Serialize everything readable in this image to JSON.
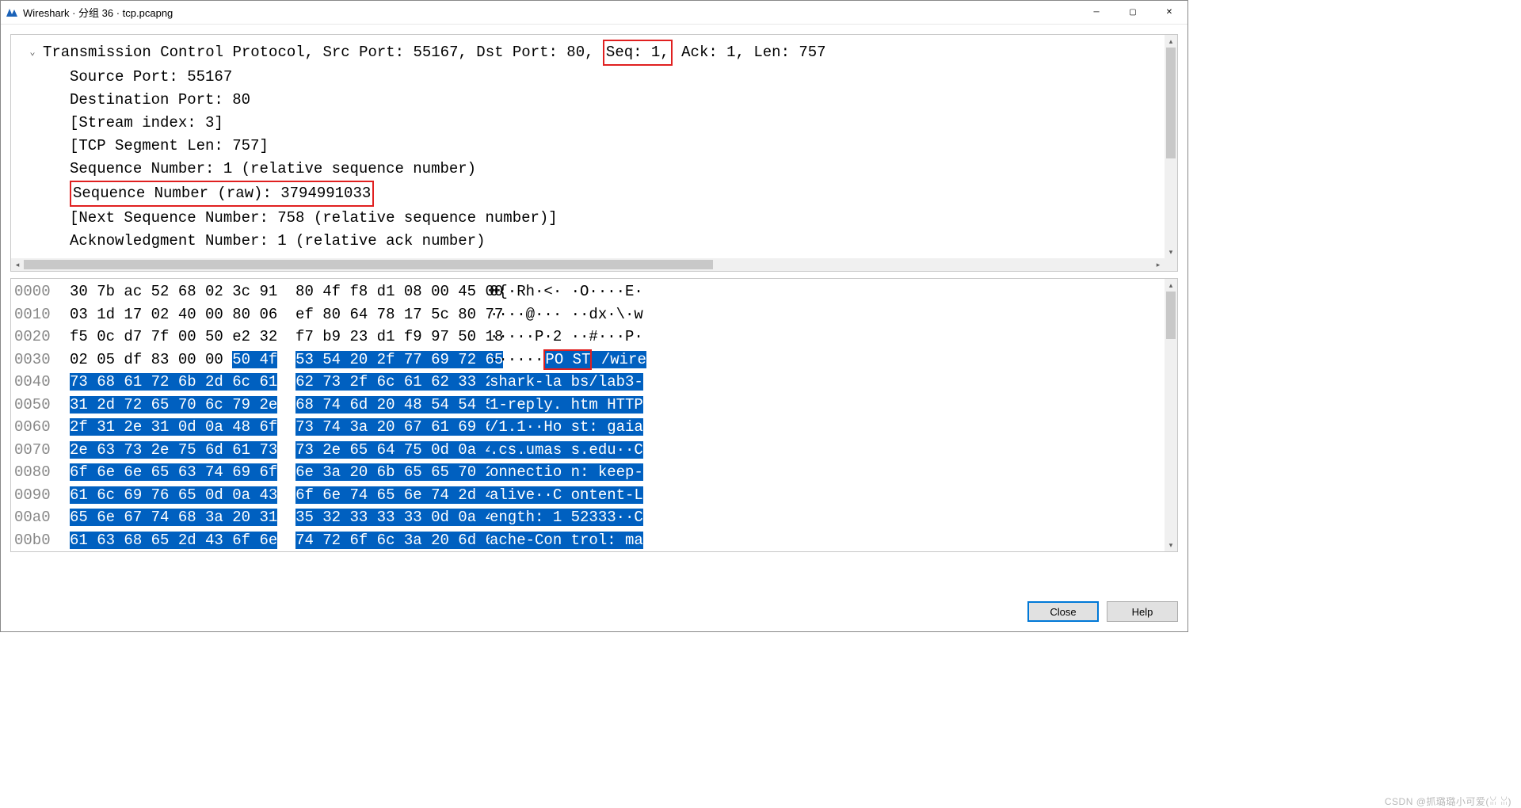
{
  "title": "Wireshark · 分组 36 · tcp.pcapng",
  "detail": {
    "header_line_pre": "Transmission Control Protocol, Src Port: 55167, Dst Port: 80, ",
    "header_line_seq": "Seq: 1,",
    "header_line_post": " Ack: 1, Len: 757",
    "lines": [
      "Source Port: 55167",
      "Destination Port: 80",
      "[Stream index: 3]",
      "[TCP Segment Len: 757]",
      "Sequence Number: 1    (relative sequence number)"
    ],
    "seq_raw_line": "Sequence Number (raw): 3794991033",
    "lines2": [
      "[Next Sequence Number: 758    (relative sequence number)]",
      "Acknowledgment Number: 1    (relative ack number)"
    ]
  },
  "hex": {
    "rows": [
      {
        "off": "0000",
        "b1": "30 7b ac 52 68 02 3c 91",
        "b2": "80 4f f8 d1 08 00 45 00",
        "a1": "0{·Rh·<·",
        "a2": " ·O····E·",
        "sel": 0
      },
      {
        "off": "0010",
        "b1": "03 1d 17 02 40 00 80 06",
        "b2": "ef 80 64 78 17 5c 80 77",
        "a1": "····@···",
        "a2": " ··dx·\\·w",
        "sel": 0
      },
      {
        "off": "0020",
        "b1": "f5 0c d7 7f 00 50 e2 32",
        "b2": "f7 b9 23 d1 f9 97 50 18",
        "a1": "·····P·2",
        "a2": " ··#···P·",
        "sel": 0
      },
      {
        "off": "0030",
        "b1p": "02 05 df 83 00 00 ",
        "b1s": "50 4f",
        "b2": "53 54 20 2f 77 69 72 65",
        "a1p": "······",
        "a1s1": "PO",
        "a1s2": " ST",
        "a2": " /wire",
        "sel": 1
      },
      {
        "off": "0040",
        "b1": "73 68 61 72 6b 2d 6c 61",
        "b2": "62 73 2f 6c 61 62 33 2d",
        "a1": "shark-la",
        "a2": " bs/lab3-",
        "sel": 2
      },
      {
        "off": "0050",
        "b1": "31 2d 72 65 70 6c 79 2e",
        "b2": "68 74 6d 20 48 54 54 50",
        "a1": "1-reply.",
        "a2": " htm HTTP",
        "sel": 2
      },
      {
        "off": "0060",
        "b1": "2f 31 2e 31 0d 0a 48 6f",
        "b2": "73 74 3a 20 67 61 69 61",
        "a1": "/1.1··Ho",
        "a2": " st: gaia",
        "sel": 2
      },
      {
        "off": "0070",
        "b1": "2e 63 73 2e 75 6d 61 73",
        "b2": "73 2e 65 64 75 0d 0a 43",
        "a1": ".cs.umas",
        "a2": " s.edu··C",
        "sel": 2
      },
      {
        "off": "0080",
        "b1": "6f 6e 6e 65 63 74 69 6f",
        "b2": "6e 3a 20 6b 65 65 70 2d",
        "a1": "onnectio",
        "a2": " n: keep-",
        "sel": 2
      },
      {
        "off": "0090",
        "b1": "61 6c 69 76 65 0d 0a 43",
        "b2": "6f 6e 74 65 6e 74 2d 4c",
        "a1": "alive··C",
        "a2": " ontent-L",
        "sel": 2
      },
      {
        "off": "00a0",
        "b1": "65 6e 67 74 68 3a 20 31",
        "b2": "35 32 33 33 33 0d 0a 43",
        "a1": "ength: 1",
        "a2": " 52333··C",
        "sel": 2
      },
      {
        "off": "00b0",
        "b1": "61 63 68 65 2d 43 6f 6e",
        "b2": "74 72 6f 6c 3a 20 6d 61",
        "a1": "ache-Con",
        "a2": " trol: ma",
        "sel": 2
      }
    ]
  },
  "buttons": {
    "close": "Close",
    "help": "Help"
  },
  "watermark": "CSDN @抓璐璐小可爱(ꈍ ꈍ)"
}
